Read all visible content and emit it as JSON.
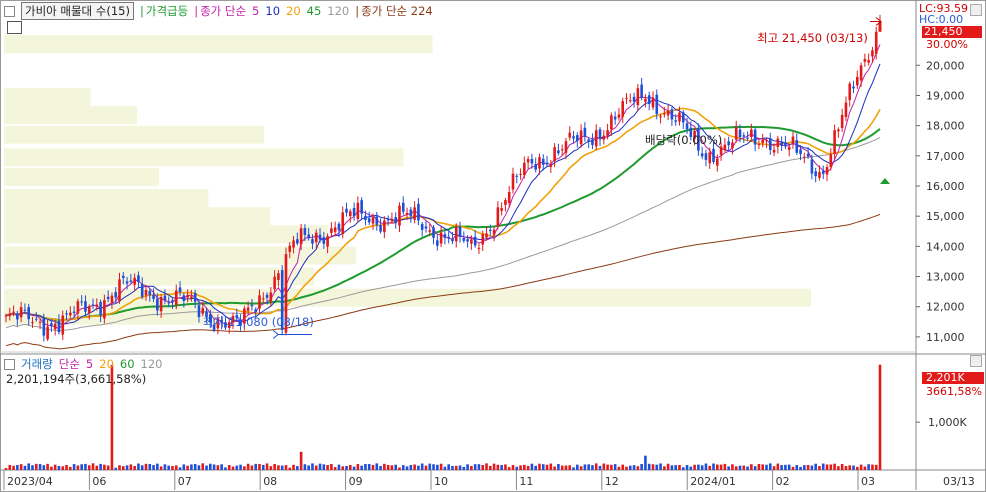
{
  "legend": {
    "title": "가비아 매물대 수(15)",
    "gainer": "가격급등",
    "ma_label": "종가 단순",
    "ma_periods": [
      "5",
      "10",
      "20",
      "45",
      "120"
    ],
    "ma224_label": "종가 단순 224"
  },
  "volume_legend": {
    "title": "거래량",
    "ma_label": "단순",
    "ma_periods": [
      "5",
      "20",
      "60",
      "120"
    ],
    "info": "2,201,194주(3,661,58%)"
  },
  "right_panel": {
    "lc": "LC:93.59",
    "hc": "HC:0.00",
    "last_price": "21,450",
    "last_pct": "30.00%",
    "volume_value": "2,201K",
    "volume_pct": "3661,58%",
    "date_label": "03/13"
  },
  "annotations": {
    "max": "최고 21,450 (03/13)",
    "min": "최저 11,080 (08/18)",
    "ex_dividend": "배당락(0.00%)"
  },
  "colors": {
    "up": "#e21a1a",
    "down": "#1e4fd8",
    "ma5": "#c21fa8",
    "ma10": "#1c2dbf",
    "ma20": "#f0a20a",
    "ma45": "#1f9a2f",
    "ma120": "#9a9a9a",
    "ma224": "#8b3a14",
    "volume_profile": "#f4f6dc"
  },
  "chart_data": {
    "type": "candlestick",
    "y_axis": {
      "ticks": [
        "20,000",
        "19,000",
        "18,000",
        "17,000",
        "16,000",
        "15,000",
        "14,000",
        "13,000",
        "12,000",
        "11,000"
      ],
      "range": [
        10500,
        21500
      ]
    },
    "volume_axis": {
      "ticks": [
        "1,000K"
      ]
    },
    "x_axis": {
      "ticks": [
        "2023/04",
        "06",
        "07",
        "08",
        "09",
        "10",
        "11",
        "12",
        "2024/01",
        "02",
        "03"
      ]
    },
    "high": 21450,
    "low": 11080,
    "last_close": 21450,
    "series_anchor_points": [
      {
        "date": "2023/04",
        "close": 11600
      },
      {
        "date": "2023/05",
        "close": 11500
      },
      {
        "date": "2023/06",
        "close": 12700
      },
      {
        "date": "2023/07",
        "close": 12200
      },
      {
        "date": "2023/08",
        "close": 11300
      },
      {
        "date": "2023/09",
        "close": 14100
      },
      {
        "date": "2023/10",
        "close": 15000
      },
      {
        "date": "2023/11",
        "close": 14900
      },
      {
        "date": "2023/12",
        "close": 13900
      },
      {
        "date": "2023/12b",
        "close": 16800
      },
      {
        "date": "2024/01",
        "close": 17600
      },
      {
        "date": "2024/01b",
        "close": 19100
      },
      {
        "date": "2024/02",
        "close": 17100
      },
      {
        "date": "2024/02b",
        "close": 17700
      },
      {
        "date": "2024/03",
        "close": 16500
      },
      {
        "date": "2024/03/13",
        "close": 21450
      }
    ],
    "volume_profile_levels": [
      {
        "price": 20700,
        "weight": 0.47
      },
      {
        "price": 18950,
        "weight": 0.095
      },
      {
        "price": 18350,
        "weight": 0.146
      },
      {
        "price": 17700,
        "weight": 0.285
      },
      {
        "price": 16950,
        "weight": 0.438
      },
      {
        "price": 16300,
        "weight": 0.17
      },
      {
        "price": 15600,
        "weight": 0.224
      },
      {
        "price": 15000,
        "weight": 0.292
      },
      {
        "price": 14400,
        "weight": 0.355
      },
      {
        "price": 13700,
        "weight": 0.386
      },
      {
        "price": 13000,
        "weight": 0.34
      },
      {
        "price": 12300,
        "weight": 0.885
      },
      {
        "price": 11700,
        "weight": 0.232
      }
    ]
  }
}
